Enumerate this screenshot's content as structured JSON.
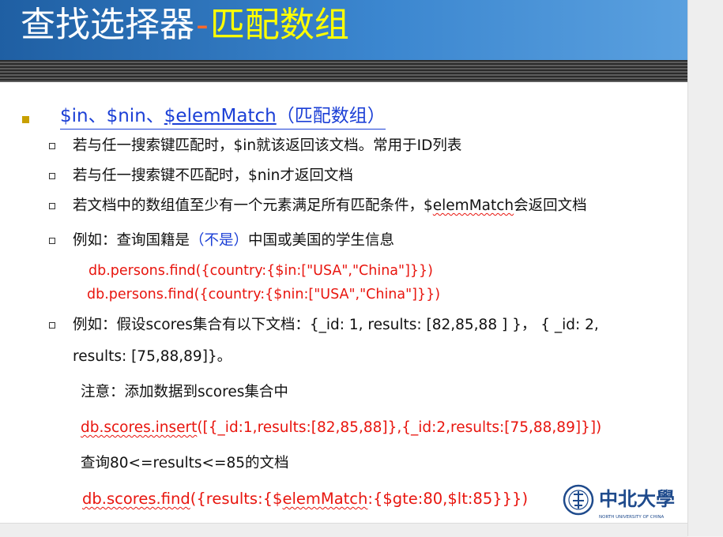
{
  "title": {
    "part1": "查找选择器",
    "separator": "-",
    "part2": "匹配数组"
  },
  "heading": {
    "prefix": "$in、$nin、",
    "elem_match": "$elemMatch",
    "suffix": "（匹配数组）"
  },
  "bullets": [
    "若与任一搜索键匹配时，$in就该返回该文档。常用于ID列表",
    "若与任一搜索键不匹配时，$nin才返回文档",
    {
      "before": "若文档中的数组值至少有一个元素满足所有匹配条件，$",
      "squiggle": "elemMatch",
      "after": "会返回文档"
    }
  ],
  "example1": {
    "prefix": "例如：查询国籍是",
    "highlight": "（不是）",
    "suffix": "中国或美国的学生信息",
    "code_lines": [
      "db.persons.find({country:{$in:[\"USA\",\"China\"]}})",
      "db.persons.find({country:{$nin:[\"USA\",\"China\"]}})"
    ]
  },
  "example2": {
    "line1": "例如：假设scores集合有以下文档：{_id: 1, results: [82,85,88 ] }，  { _id: 2,",
    "line2": "results: [75,88,89]}。",
    "note": "注意：添加数据到scores集合中",
    "insert_code": {
      "squiggle": "db.scores.insert",
      "rest": "([{_id:1,results:[82,85,88]},{_id:2,results:[75,88,89]}])"
    },
    "query_label": "查询80<=results<=85的文档",
    "find_code": {
      "squiggle1": "db.scores.find",
      "mid": "({results:{$",
      "squiggle2": "elemMatch",
      "rest": ":{$gte:80,$lt:85}}})"
    }
  },
  "logo": {
    "name": "中北大學",
    "english": "NORTH UNIVERSITY OF CHINA"
  },
  "colors": {
    "title_bg": "#3b86cf",
    "title_yellow": "#ffff00",
    "heading_blue": "#1b3fd6",
    "code_red": "#e8150e",
    "bullet_gold": "#c8a000"
  }
}
